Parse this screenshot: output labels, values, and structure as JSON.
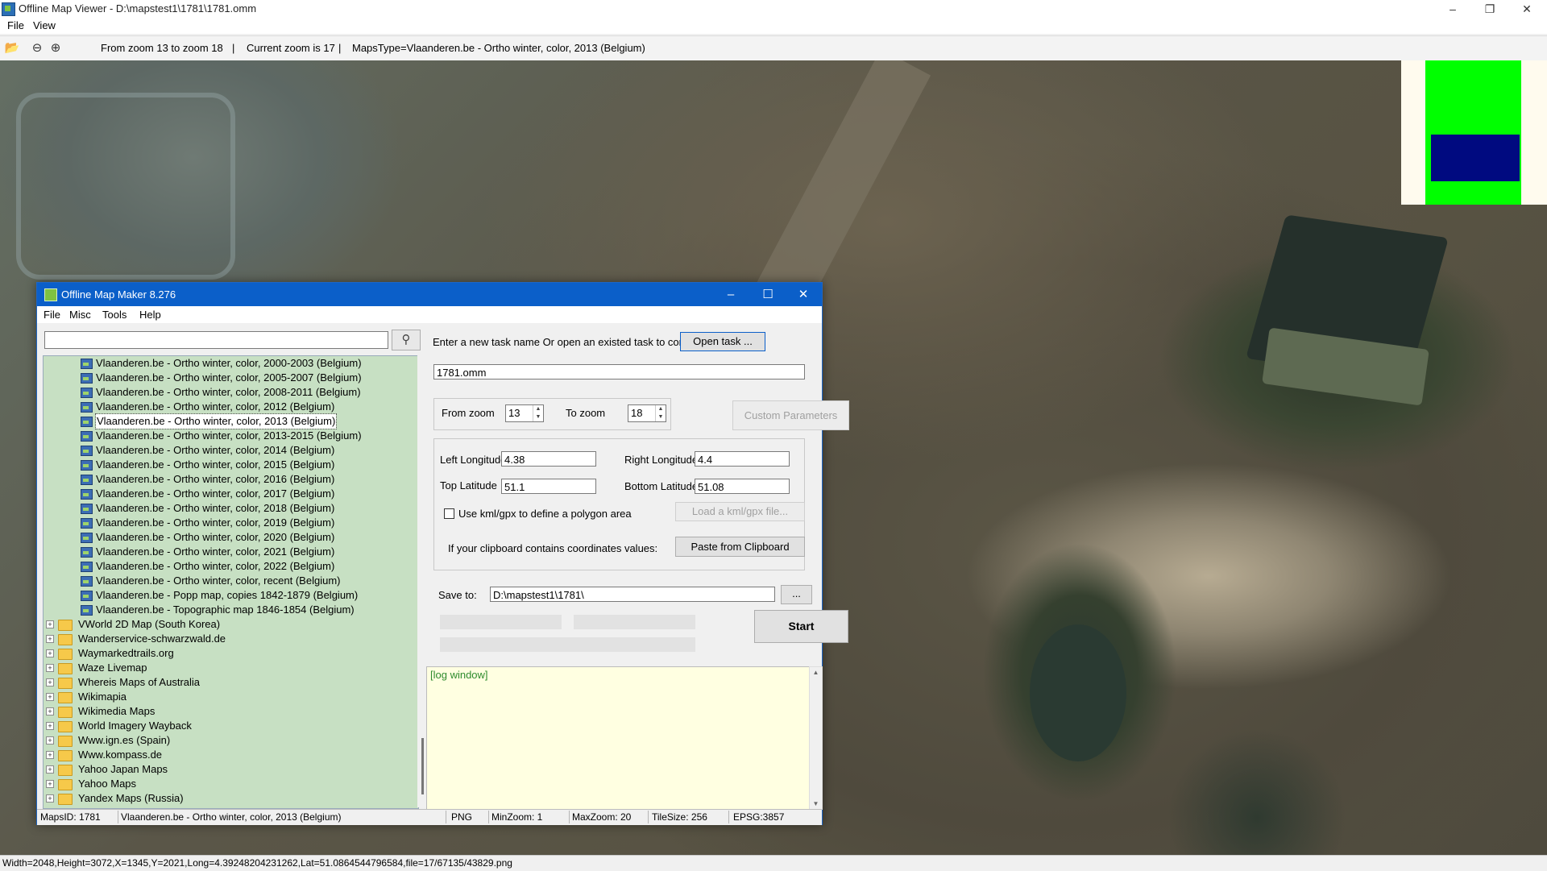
{
  "app": {
    "title": "Offline Map Viewer - D:\\mapstest1\\1781\\1781.omm",
    "minimize_icon": "minimize-icon",
    "maximize_icon": "maximize-icon",
    "close_icon": "close-icon"
  },
  "menu": {
    "file": "File",
    "view": "View"
  },
  "toolbar": {
    "zoom_range": "From zoom 13 to zoom 18",
    "sep1": "|",
    "current_zoom": "Current zoom is 17",
    "sep2": "|",
    "maps_type": "MapsType=Vlaanderen.be - Ortho winter, color, 2013 (Belgium)"
  },
  "statusbar": {
    "text": "Width=2048,Height=3072,X=1345,Y=2021,Long=4.39248204231262,Lat=51.0864544796584,file=17/67135/43829.png"
  },
  "dialog": {
    "title": "Offline Map Maker 8.276",
    "menu": [
      "File",
      "Misc",
      "Tools",
      "Help"
    ],
    "search": {
      "value": "",
      "icon": "search-icon"
    },
    "tree": {
      "children": [
        "Vlaanderen.be - Ortho winter, color, 2000-2003 (Belgium)",
        "Vlaanderen.be - Ortho winter, color, 2005-2007 (Belgium)",
        "Vlaanderen.be - Ortho winter, color, 2008-2011 (Belgium)",
        "Vlaanderen.be - Ortho winter, color, 2012 (Belgium)",
        "Vlaanderen.be - Ortho winter, color, 2013 (Belgium)",
        "Vlaanderen.be - Ortho winter, color, 2013-2015 (Belgium)",
        "Vlaanderen.be - Ortho winter, color, 2014 (Belgium)",
        "Vlaanderen.be - Ortho winter, color, 2015 (Belgium)",
        "Vlaanderen.be - Ortho winter, color, 2016 (Belgium)",
        "Vlaanderen.be - Ortho winter, color, 2017 (Belgium)",
        "Vlaanderen.be - Ortho winter, color, 2018 (Belgium)",
        "Vlaanderen.be - Ortho winter, color, 2019 (Belgium)",
        "Vlaanderen.be - Ortho winter, color, 2020 (Belgium)",
        "Vlaanderen.be - Ortho winter, color, 2021 (Belgium)",
        "Vlaanderen.be - Ortho winter, color, 2022 (Belgium)",
        "Vlaanderen.be - Ortho winter, color, recent (Belgium)",
        "Vlaanderen.be - Popp map, copies 1842-1879 (Belgium)",
        "Vlaanderen.be - Topographic map 1846-1854 (Belgium)"
      ],
      "selected": "Vlaanderen.be - Ortho winter, color, 2013 (Belgium)",
      "folders": [
        "VWorld 2D Map (South Korea)",
        "Wanderservice-schwarzwald.de",
        "Waymarkedtrails.org",
        "Waze Livemap",
        "Whereis Maps of Australia",
        "Wikimapia",
        "Wikimedia Maps",
        "World Imagery Wayback",
        "Www.ign.es (Spain)",
        "Www.kompass.de",
        "Yahoo Japan Maps",
        "Yahoo Maps",
        "Yandex Maps (Russia)"
      ]
    },
    "task": {
      "prompt": "Enter a new task name Or open an existed task to continue:",
      "open_button": "Open task ...",
      "task_name": "1781.omm"
    },
    "zoom": {
      "from_label": "From zoom",
      "from_value": "13",
      "to_label": "To zoom",
      "to_value": "18",
      "custom_button": "Custom Parameters"
    },
    "coords": {
      "left_lon_label": "Left Longitude",
      "left_lon": "4.38",
      "right_lon_label": "Right Longitude",
      "right_lon": "4.4",
      "top_lat_label": "Top Latitude",
      "top_lat": "51.1",
      "bottom_lat_label": "Bottom Latitude",
      "bottom_lat": "51.08",
      "kml_label": "Use kml/gpx to define a polygon area",
      "kml_checked": false,
      "load_kml_button": "Load a kml/gpx file...",
      "clipboard_label": "If your clipboard contains coordinates values:",
      "paste_button": "Paste from Clipboard"
    },
    "save": {
      "label": "Save to:",
      "path": "D:\\mapstest1\\1781\\",
      "browse_button": "..."
    },
    "start_button": "Start",
    "log": "[log window]",
    "status": {
      "maps_id": "MapsID: 1781",
      "map_name": "Vlaanderen.be - Ortho winter, color, 2013 (Belgium)",
      "format": "PNG",
      "min_zoom": "MinZoom: 1",
      "max_zoom": "MaxZoom: 20",
      "tile_size": "TileSize: 256",
      "epsg": "EPSG:3857"
    }
  },
  "colors": {
    "dialog_title": "#0b5fc9",
    "tree_bg": "#c7e0c3",
    "log_bg": "#ffffe1",
    "overview_green": "#00ff00",
    "overview_blue": "#000a80"
  }
}
